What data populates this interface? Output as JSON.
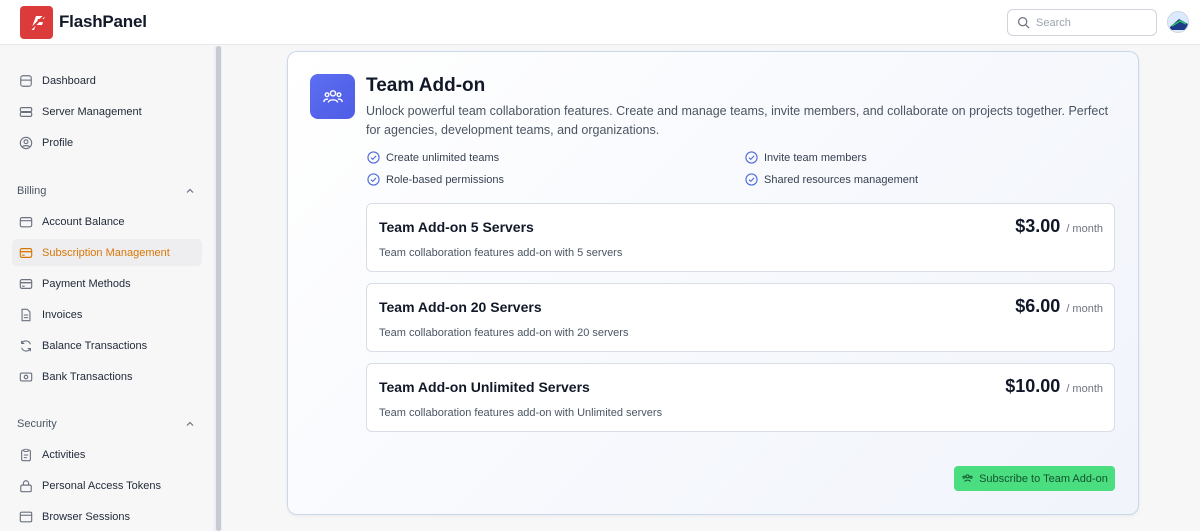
{
  "app": {
    "brand": "FlashPanel"
  },
  "search": {
    "placeholder": "Search",
    "value": ""
  },
  "sidebar": {
    "top_items": [
      {
        "label": "Dashboard",
        "icon": "dashboard-icon"
      },
      {
        "label": "Server Management",
        "icon": "server-icon"
      },
      {
        "label": "Profile",
        "icon": "profile-icon"
      }
    ],
    "billing": {
      "label": "Billing",
      "items": [
        {
          "label": "Account Balance",
          "icon": "wallet-icon"
        },
        {
          "label": "Subscription Management",
          "icon": "credit-card-icon",
          "active": true
        },
        {
          "label": "Payment Methods",
          "icon": "credit-card-icon"
        },
        {
          "label": "Invoices",
          "icon": "document-icon"
        },
        {
          "label": "Balance Transactions",
          "icon": "refresh-icon"
        },
        {
          "label": "Bank Transactions",
          "icon": "bank-icon"
        }
      ]
    },
    "security": {
      "label": "Security",
      "items": [
        {
          "label": "Activities",
          "icon": "clipboard-icon"
        },
        {
          "label": "Personal Access Tokens",
          "icon": "lock-icon"
        },
        {
          "label": "Browser Sessions",
          "icon": "browser-icon"
        }
      ]
    }
  },
  "addon": {
    "title": "Team Add-on",
    "description": "Unlock powerful team collaboration features. Create and manage teams, invite members, and collaborate on projects together. Perfect for agencies, development teams, and organizations.",
    "features": [
      "Create unlimited teams",
      "Invite team members",
      "Role-based permissions",
      "Shared resources management"
    ],
    "plans": [
      {
        "name": "Team Add-on 5 Servers",
        "description": "Team collaboration features add-on with 5 servers",
        "price": "$3.00",
        "period": "/ month"
      },
      {
        "name": "Team Add-on 20 Servers",
        "description": "Team collaboration features add-on with 20 servers",
        "price": "$6.00",
        "period": "/ month"
      },
      {
        "name": "Team Add-on Unlimited Servers",
        "description": "Team collaboration features add-on with Unlimited servers",
        "price": "$10.00",
        "period": "/ month"
      }
    ],
    "subscribe_label": "Subscribe to Team Add-on"
  },
  "colors": {
    "accent": "#d97706",
    "brand": "#dc3b3b",
    "icon_bg": "#5b6ef0",
    "subscribe_bg": "#4ade80"
  }
}
